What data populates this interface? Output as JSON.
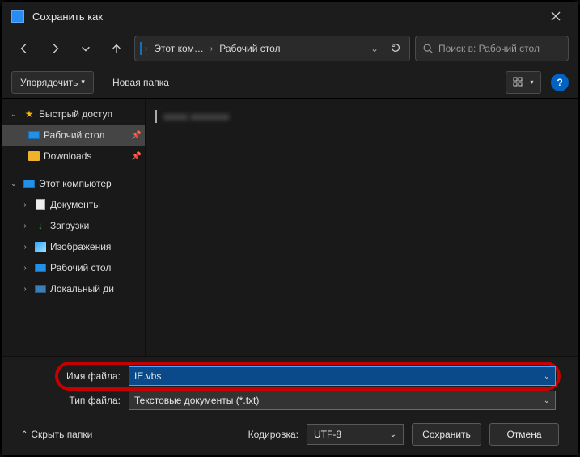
{
  "titlebar": {
    "title": "Сохранить как"
  },
  "nav": {
    "crumbs": [
      "Этот ком…",
      "Рабочий стол"
    ],
    "search_placeholder": "Поиск в: Рабочий стол"
  },
  "toolbar": {
    "organize": "Упорядочить",
    "new_folder": "Новая папка",
    "help": "?"
  },
  "tree": {
    "quick": "Быстрый доступ",
    "quick_items": [
      {
        "label": "Рабочий стол",
        "selected": true,
        "icon": "desktop",
        "pinned": true
      },
      {
        "label": "Downloads",
        "icon": "folder",
        "pinned": true
      }
    ],
    "pc": "Этот компьютер",
    "pc_items": [
      {
        "label": "Документы",
        "icon": "doc"
      },
      {
        "label": "Загрузки",
        "icon": "download"
      },
      {
        "label": "Изображения",
        "icon": "image"
      },
      {
        "label": "Рабочий стол",
        "icon": "desktop"
      },
      {
        "label": "Локальный ди",
        "icon": "disk"
      }
    ]
  },
  "files": [
    {
      "blurred_name": "xxxxx xxxxxxxx"
    }
  ],
  "form": {
    "filename_label": "Имя файла:",
    "filename_value": "IE.vbs",
    "filetype_label": "Тип файла:",
    "filetype_value": "Текстовые документы (*.txt)",
    "encoding_label": "Кодировка:",
    "encoding_value": "UTF-8",
    "hide_folders": "Скрыть папки",
    "save": "Сохранить",
    "cancel": "Отмена"
  }
}
